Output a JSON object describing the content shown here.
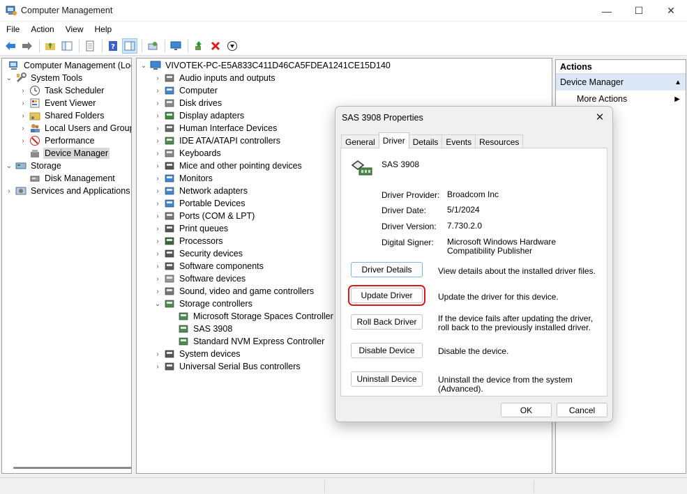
{
  "window": {
    "title": "Computer Management",
    "minimize": "—",
    "maximize": "☐",
    "close": "✕"
  },
  "menu": [
    "File",
    "Action",
    "View",
    "Help"
  ],
  "left_tree": {
    "root": "Computer Management (Local",
    "system_tools": "System Tools",
    "task_scheduler": "Task Scheduler",
    "event_viewer": "Event Viewer",
    "shared_folders": "Shared Folders",
    "local_users": "Local Users and Groups",
    "performance": "Performance",
    "device_manager": "Device Manager",
    "storage": "Storage",
    "disk_management": "Disk Management",
    "services_apps": "Services and Applications"
  },
  "device_tree": {
    "root": "VIVOTEK-PC-E5A833C411D46CA5FDEA1241CE15D140",
    "categories": [
      "Audio inputs and outputs",
      "Computer",
      "Disk drives",
      "Display adapters",
      "Human Interface Devices",
      "IDE ATA/ATAPI controllers",
      "Keyboards",
      "Mice and other pointing devices",
      "Monitors",
      "Network adapters",
      "Portable Devices",
      "Ports (COM & LPT)",
      "Print queues",
      "Processors",
      "Security devices",
      "Software components",
      "Software devices",
      "Sound, video and game controllers",
      "Storage controllers"
    ],
    "storage_children": [
      "Microsoft Storage Spaces Controller",
      "SAS 3908",
      "Standard NVM Express Controller"
    ],
    "after": [
      "System devices",
      "Universal Serial Bus controllers"
    ]
  },
  "actions": {
    "header": "Actions",
    "section": "Device Manager",
    "more": "More Actions"
  },
  "dialog": {
    "title": "SAS 3908 Properties",
    "tabs": [
      "General",
      "Driver",
      "Details",
      "Events",
      "Resources"
    ],
    "active_tab": "Driver",
    "device_name": "SAS 3908",
    "provider_label": "Driver Provider:",
    "provider_value": "Broadcom Inc",
    "date_label": "Driver Date:",
    "date_value": "5/1/2024",
    "version_label": "Driver Version:",
    "version_value": "7.730.2.0",
    "signer_label": "Digital Signer:",
    "signer_value": "Microsoft Windows Hardware Compatibility Publisher",
    "buttons": {
      "details": "Driver Details",
      "details_desc": "View details about the installed driver files.",
      "update": "Update Driver",
      "update_desc": "Update the driver for this device.",
      "rollback": "Roll Back Driver",
      "rollback_desc": "If the device fails after updating the driver, roll back to the previously installed driver.",
      "disable": "Disable Device",
      "disable_desc": "Disable the device.",
      "uninstall": "Uninstall Device",
      "uninstall_desc": "Uninstall the device from the system (Advanced)."
    },
    "ok": "OK",
    "cancel": "Cancel"
  },
  "colors": {
    "highlight": "#d9191a",
    "selection": "#d9d9d9",
    "actions_bar": "#dce8f5",
    "accent": "#0078d4"
  }
}
